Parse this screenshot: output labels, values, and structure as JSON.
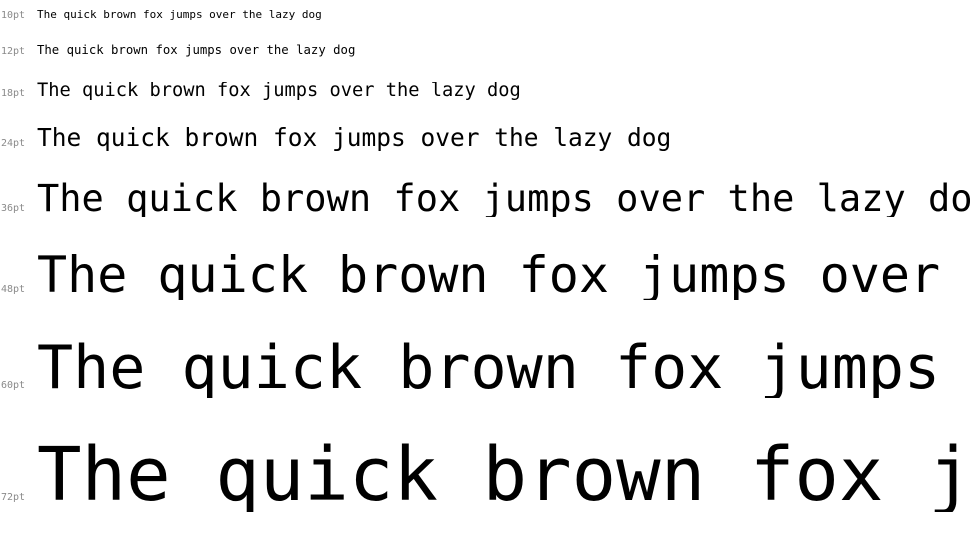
{
  "sample_text": "The quick brown fox jumps over the lazy dog",
  "rows": [
    {
      "label": "10pt",
      "text": "The quick brown fox jumps over the lazy dog"
    },
    {
      "label": "12pt",
      "text": "The quick brown fox jumps over the lazy dog"
    },
    {
      "label": "18pt",
      "text": "The quick brown fox jumps over the lazy dog"
    },
    {
      "label": "24pt",
      "text": "The quick brown fox jumps over the lazy dog"
    },
    {
      "label": "36pt",
      "text": "The quick brown fox jumps over the lazy dog"
    },
    {
      "label": "48pt",
      "text": "The quick brown fox jumps over the lazy dog"
    },
    {
      "label": "60pt",
      "text": "The quick brown fox jumps over the lazy dog"
    },
    {
      "label": "72pt",
      "text": "The quick brown fox jumps over the lazy dog"
    }
  ],
  "colors": {
    "text": "#000000",
    "label": "#8a8a8a",
    "background": "#ffffff"
  }
}
